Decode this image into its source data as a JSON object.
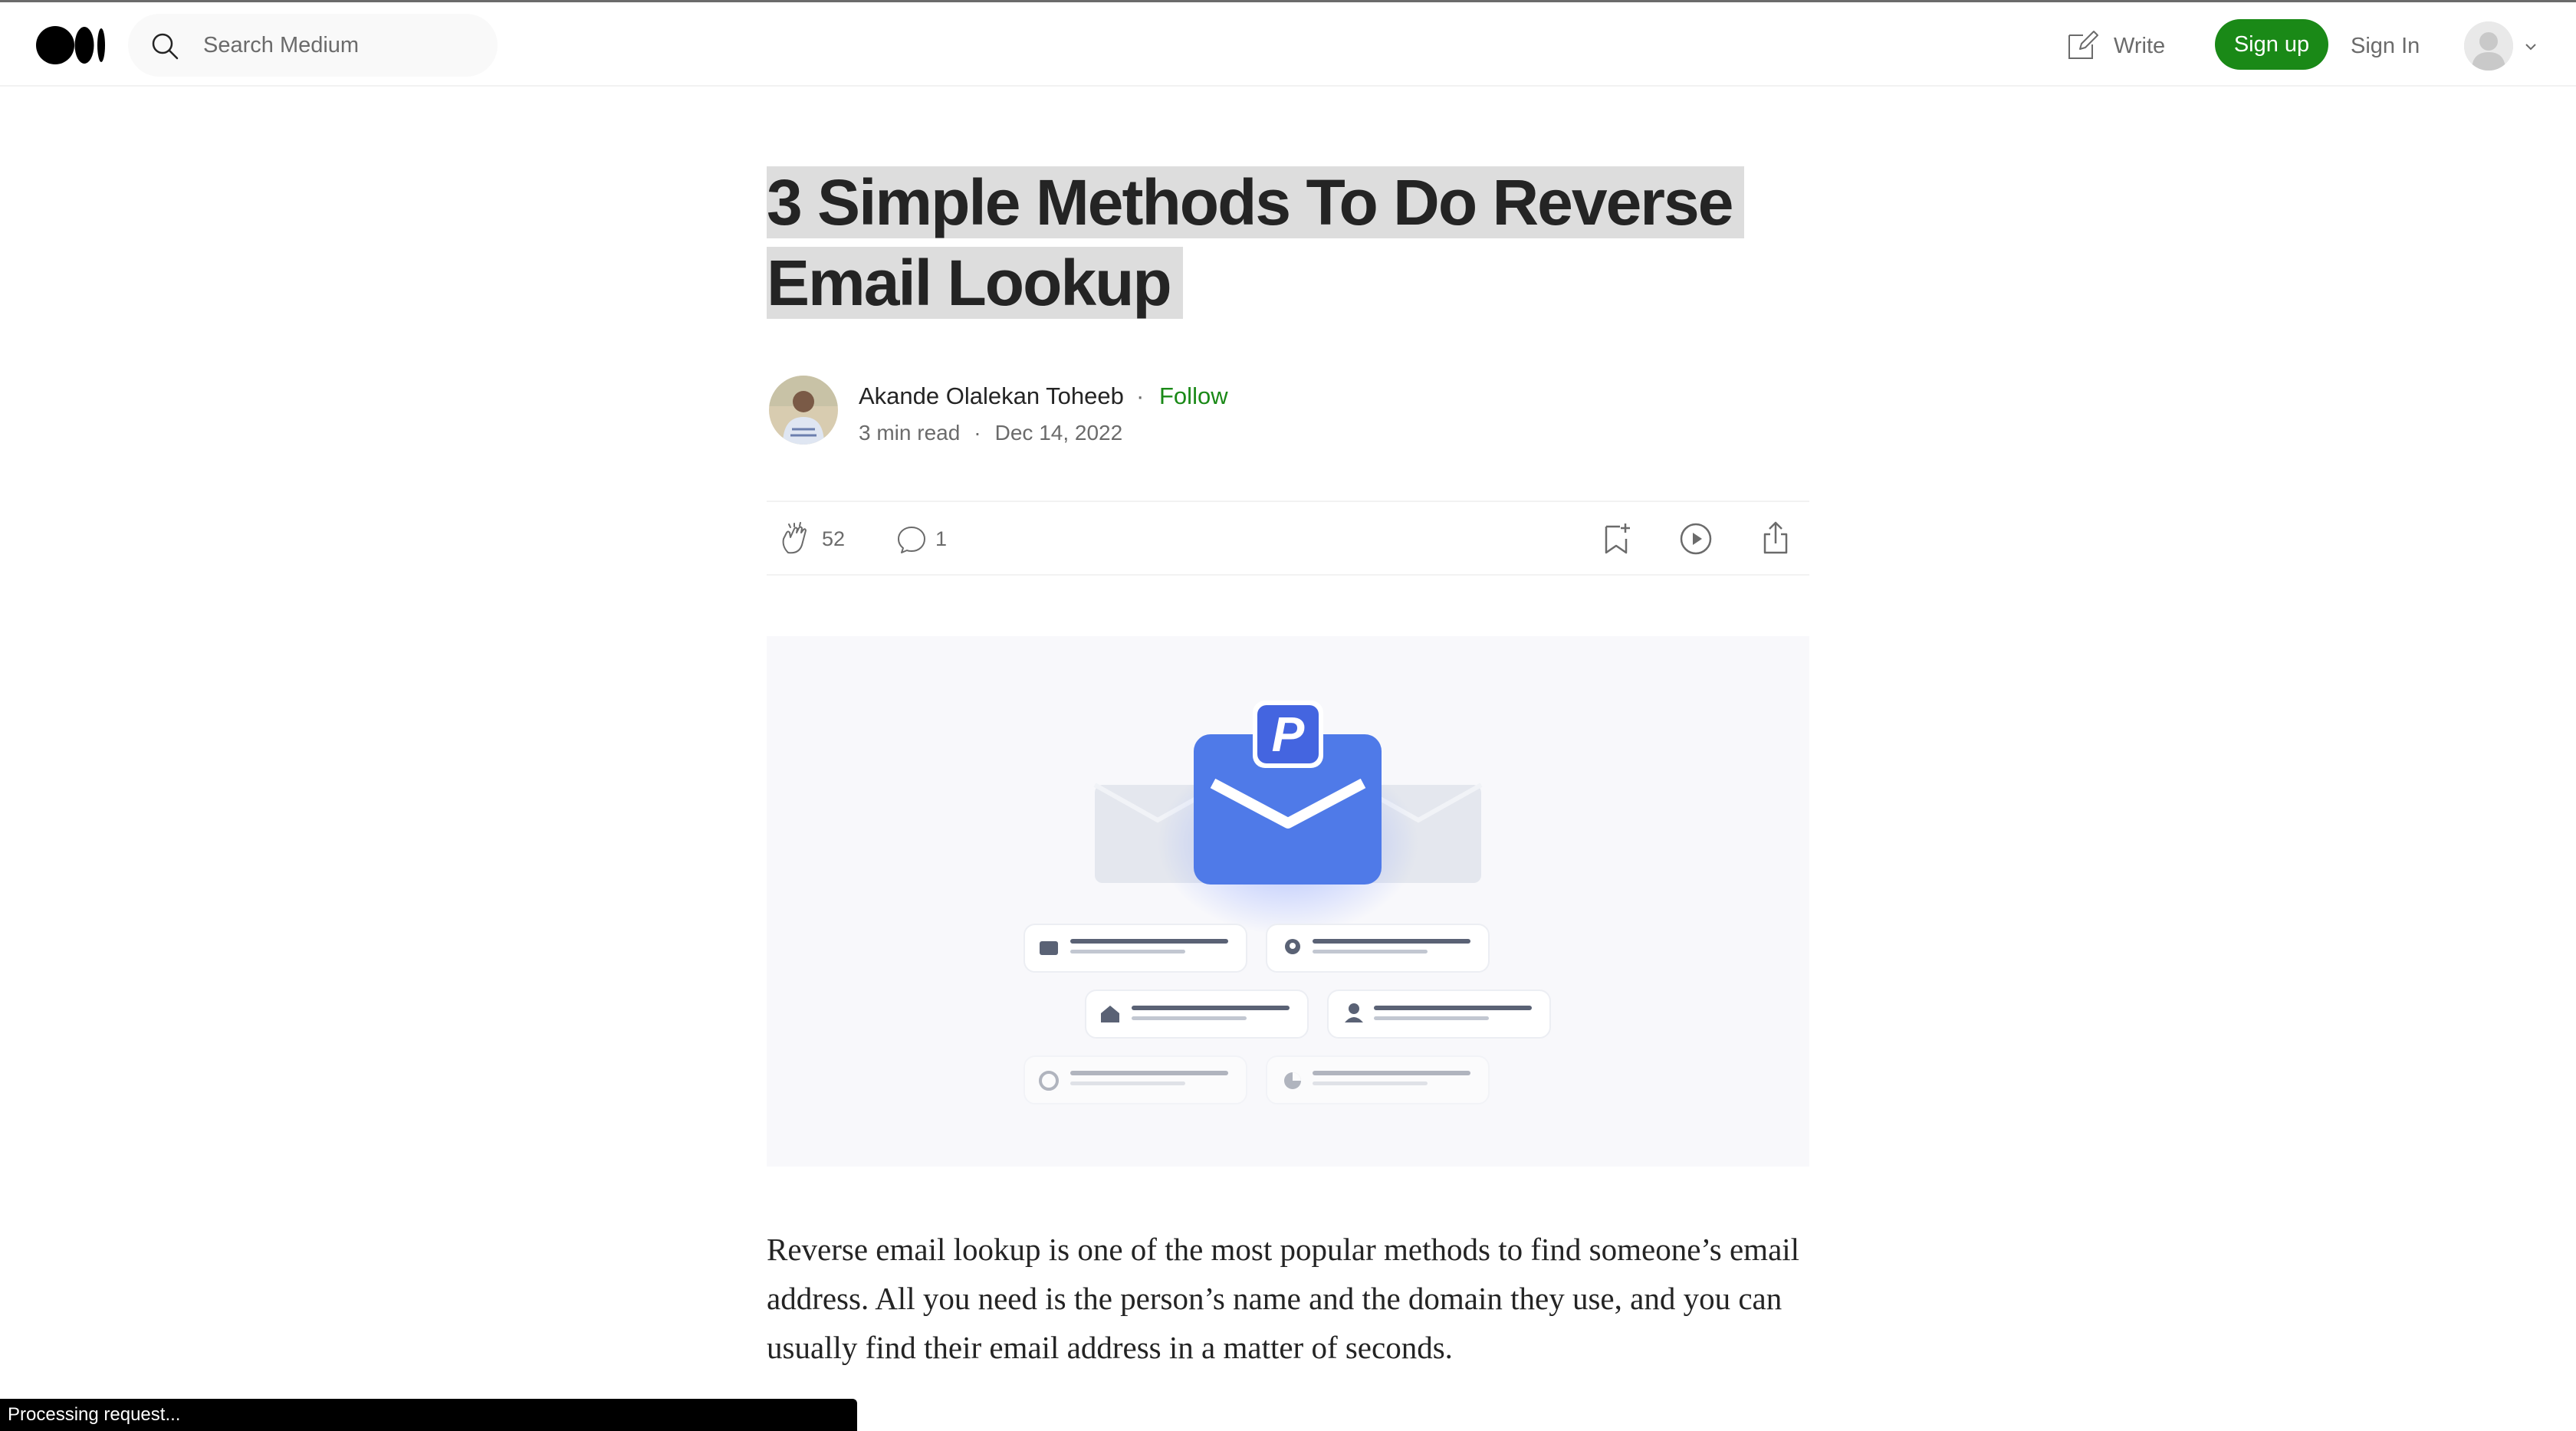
{
  "header": {
    "logo_icon": "medium-logo-icon",
    "search": {
      "placeholder": "Search Medium",
      "value": ""
    },
    "write_label": "Write",
    "signup_label": "Sign up",
    "signin_label": "Sign In",
    "avatar_icon": "user-avatar-icon"
  },
  "article": {
    "title_line1": "3 Simple Methods To Do Reverse",
    "title_line2": "Email Lookup",
    "author": {
      "name": "Akande Olalekan Toheeb",
      "separator": "·",
      "follow_label": "Follow"
    },
    "meta": {
      "read_time": "3 min read",
      "separator": "·",
      "date": "Dec 14, 2022"
    },
    "actions": {
      "claps": "52",
      "responses": "1"
    },
    "body_paragraph": "Reverse email lookup is one of the most popular methods to find someone’s email address. All you need is the person’s name and the domain they use, and you can usually find their email address in a matter of seconds."
  },
  "status_bar": {
    "text": "Processing request..."
  },
  "colors": {
    "brand_green": "#1a8917",
    "text_primary": "#242424",
    "text_secondary": "#6b6b6b",
    "title_highlight": "#dddddd",
    "hero_envelope": "#4f7ae8"
  }
}
